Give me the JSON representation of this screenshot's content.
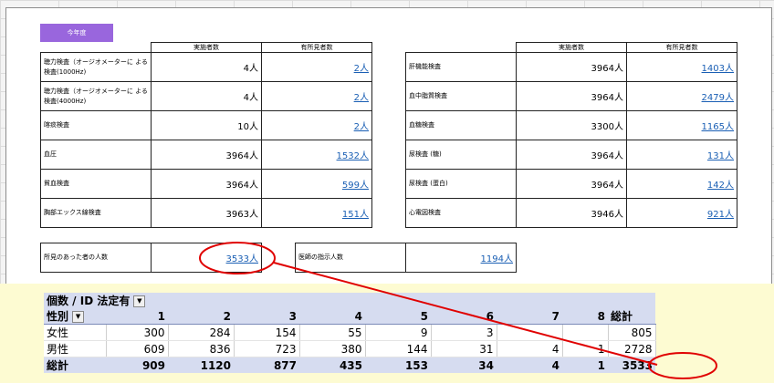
{
  "year_label": "今年度",
  "headers": {
    "performed": "実施者数",
    "findings": "有所見者数"
  },
  "left_rows": [
    {
      "name": "聴力検査（オージオメーターに よる検査(1000Hz)",
      "count": "4人",
      "findings": "2人"
    },
    {
      "name": "聴力検査（オージオメーターに よる検査(4000Hz)",
      "count": "4人",
      "findings": "2人"
    },
    {
      "name": "喀痰検査",
      "count": "10人",
      "findings": "2人"
    },
    {
      "name": "血圧",
      "count": "3964人",
      "findings": "1532人"
    },
    {
      "name": "貧血検査",
      "count": "3964人",
      "findings": "599人"
    },
    {
      "name": "胸部エックス線検査",
      "count": "3963人",
      "findings": "151人"
    }
  ],
  "right_rows": [
    {
      "name": "肝機能検査",
      "count": "3964人",
      "findings": "1403人"
    },
    {
      "name": "血中脂質検査",
      "count": "3964人",
      "findings": "2479人"
    },
    {
      "name": "血糖検査",
      "count": "3300人",
      "findings": "1165人"
    },
    {
      "name": "尿検査 (糖)",
      "count": "3964人",
      "findings": "131人"
    },
    {
      "name": "尿検査 (蛋白)",
      "count": "3964人",
      "findings": "142人"
    },
    {
      "name": "心電図検査",
      "count": "3946人",
      "findings": "921人"
    }
  ],
  "summary": {
    "findings_label": "所見のあった者の人数",
    "findings_value": "3533人",
    "doctor_label": "医師の指示人数",
    "doctor_value": "1194人"
  },
  "pivot": {
    "title": "個数 / ID",
    "filter_label": "法定有",
    "row_field": "性別",
    "columns": [
      "1",
      "2",
      "3",
      "4",
      "5",
      "6",
      "7",
      "8",
      "総計"
    ],
    "rows": [
      {
        "label": "女性",
        "values": [
          "300",
          "284",
          "154",
          "55",
          "9",
          "3",
          "",
          "",
          "805"
        ]
      },
      {
        "label": "男性",
        "values": [
          "609",
          "836",
          "723",
          "380",
          "144",
          "31",
          "4",
          "1",
          "2728"
        ]
      }
    ],
    "total": {
      "label": "総計",
      "values": [
        "909",
        "1120",
        "877",
        "435",
        "153",
        "34",
        "4",
        "1",
        "3533"
      ]
    }
  },
  "annotation_color": "#e00000"
}
